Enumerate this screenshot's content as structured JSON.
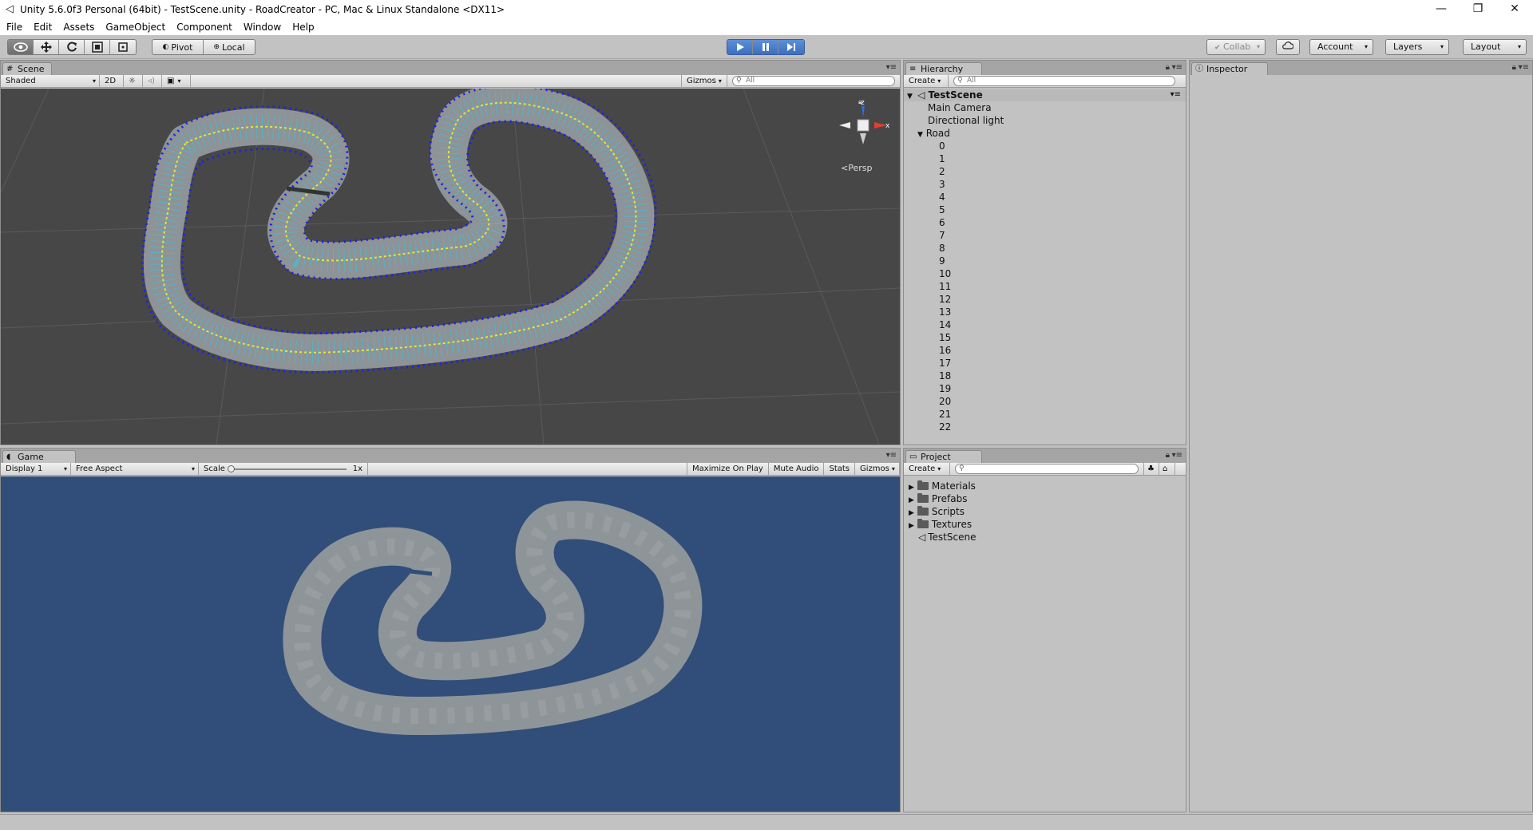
{
  "window": {
    "title": "Unity 5.6.0f3 Personal (64bit) - TestScene.unity - RoadCreator - PC, Mac & Linux Standalone <DX11>",
    "minimize": "—",
    "restore": "❐",
    "close": "✕"
  },
  "menu": [
    "File",
    "Edit",
    "Assets",
    "GameObject",
    "Component",
    "Window",
    "Help"
  ],
  "toolbar": {
    "pivot": "Pivot",
    "local": "Local",
    "collab": "Collab",
    "account": "Account",
    "layers": "Layers",
    "layout": "Layout"
  },
  "scene": {
    "tab": "Scene",
    "shading": "Shaded",
    "mode2d": "2D",
    "gizmos": "Gizmos",
    "search_placeholder": "All",
    "persp": "Persp",
    "axis_z": "z",
    "axis_x": "x"
  },
  "game": {
    "tab": "Game",
    "display": "Display 1",
    "aspect": "Free Aspect",
    "scale_label": "Scale",
    "scale_value": "1x",
    "maximize": "Maximize On Play",
    "mute": "Mute Audio",
    "stats": "Stats",
    "gizmos": "Gizmos",
    "background": "#314d79"
  },
  "hierarchy": {
    "tab": "Hierarchy",
    "create": "Create",
    "search_placeholder": "All",
    "scene_name": "TestScene",
    "objects": [
      "Main Camera",
      "Directional light"
    ],
    "road": "Road",
    "road_children": [
      "0",
      "1",
      "2",
      "3",
      "4",
      "5",
      "6",
      "7",
      "8",
      "9",
      "10",
      "11",
      "12",
      "13",
      "14",
      "15",
      "16",
      "17",
      "18",
      "19",
      "20",
      "21",
      "22"
    ]
  },
  "project": {
    "tab": "Project",
    "create": "Create",
    "folders": [
      "Materials",
      "Prefabs",
      "Scripts",
      "Textures"
    ],
    "scene_asset": "TestScene"
  },
  "inspector": {
    "tab": "Inspector"
  },
  "colors": {
    "scene_bg": "#474747",
    "road": "#8d9396",
    "spline_point": "#1a22e6",
    "normal_lines": "#33c8e6",
    "center_line": "#e6e633"
  }
}
